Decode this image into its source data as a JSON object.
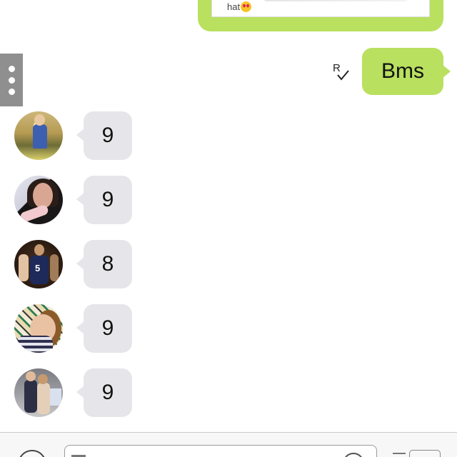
{
  "previous_message": {
    "caption_fragment": "hat"
  },
  "sent_message": {
    "text": "Bms",
    "read_receipt": "R"
  },
  "incoming_messages": [
    {
      "text": "9"
    },
    {
      "text": "9"
    },
    {
      "text": "8"
    },
    {
      "text": "9"
    },
    {
      "text": "9"
    }
  ],
  "avatars": {
    "jersey_number": "5"
  },
  "icons": {
    "side_menu": "more-vertical-icon",
    "read_receipt": "read-checkmark-icon",
    "attach": "plus-icon",
    "emoji": "emoji-icon",
    "menu": "menu-lines-icon"
  },
  "colors": {
    "sent_bubble": "#b9e05f",
    "received_bubble": "#e6e6ea",
    "side_tab": "#8f8f8f"
  }
}
